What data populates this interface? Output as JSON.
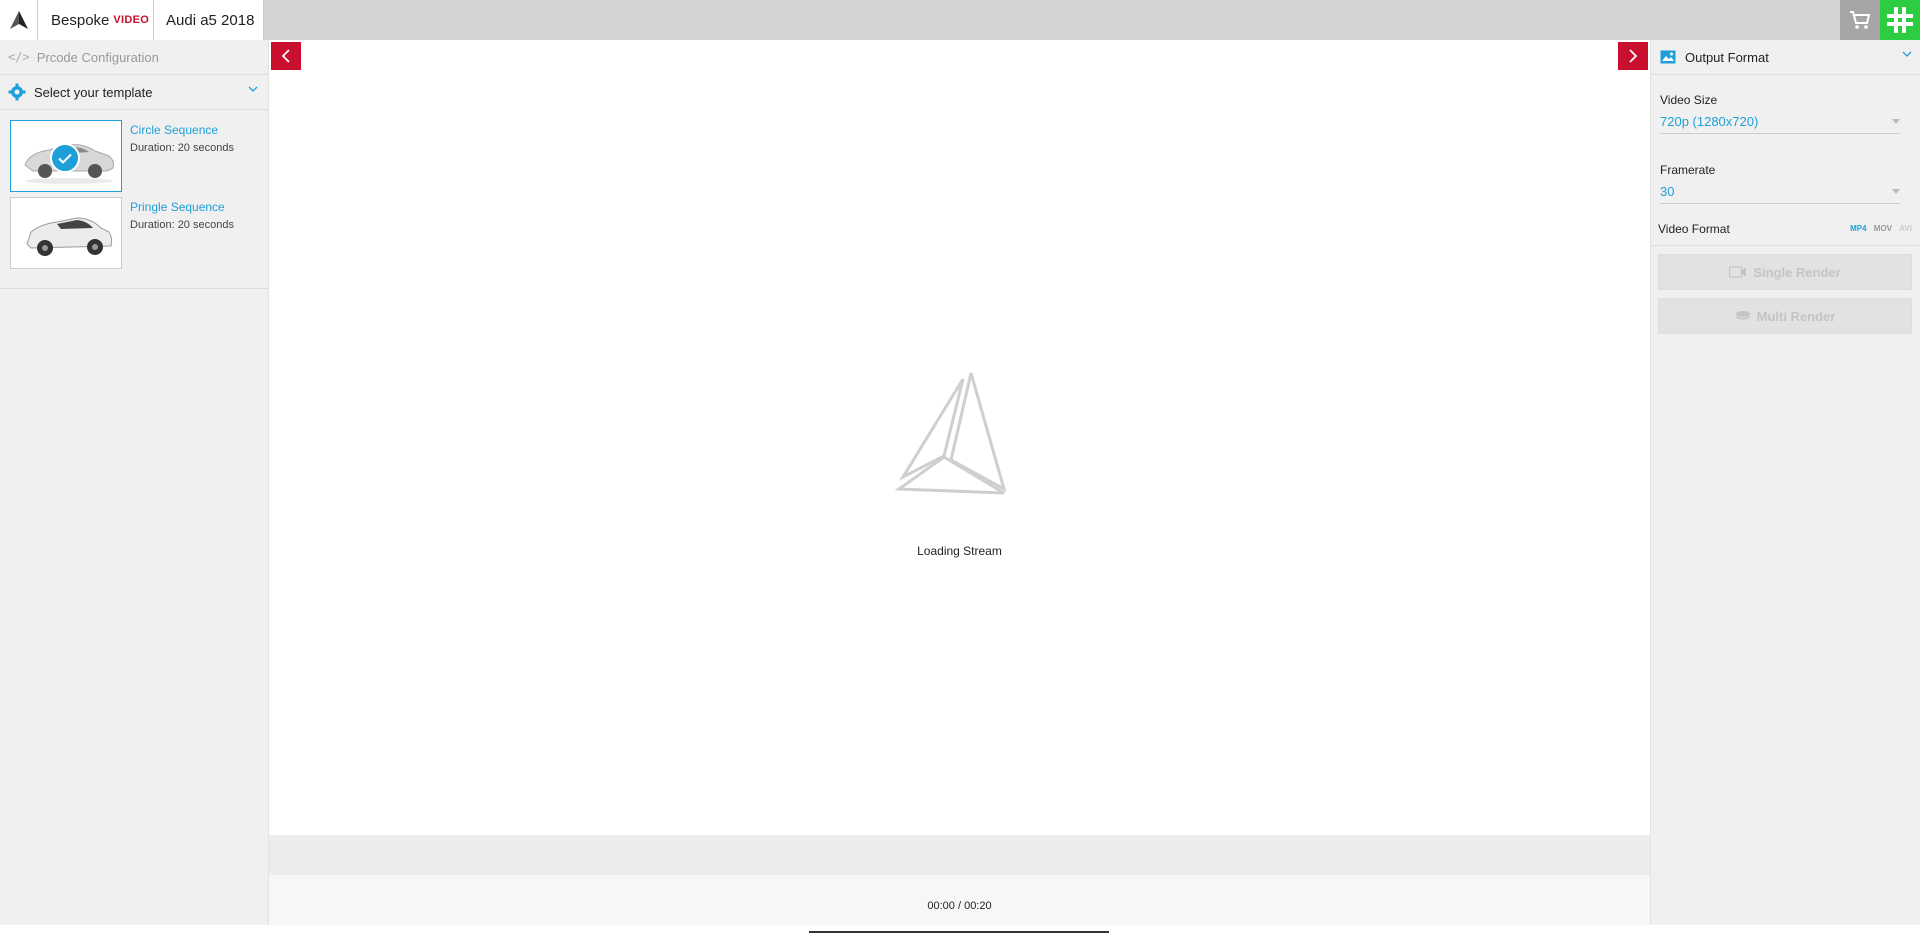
{
  "header": {
    "app_name": "Bespoke",
    "app_suffix": "VIDEO",
    "project_tab": "Audi a5 2018",
    "icons": [
      "logo-icon",
      "cart-icon",
      "extension-icon"
    ]
  },
  "sidebar": {
    "prcode_label": "Prcode Configuration",
    "template_select_label": "Select your template",
    "templates": [
      {
        "name": "Circle Sequence",
        "duration": "Duration: 20 seconds",
        "selected": true
      },
      {
        "name": "Pringle Sequence",
        "duration": "Duration: 20 seconds",
        "selected": false
      }
    ]
  },
  "viewport": {
    "loading_text": "Loading Stream",
    "timecode": "00:00 / 00:20"
  },
  "output": {
    "title": "Output Format",
    "video_size_label": "Video Size",
    "video_size_value": "720p (1280x720)",
    "framerate_label": "Framerate",
    "framerate_value": "30",
    "video_format_label": "Video Format",
    "formats": [
      "MP4",
      "MOV",
      "AVI"
    ],
    "selected_format": "MP4",
    "single_render_label": "Single Render",
    "multi_render_label": "Multi Render"
  },
  "colors": {
    "accent": "#1e9fd8",
    "brand_red": "#c8102e",
    "extension_green": "#2ecc40"
  }
}
